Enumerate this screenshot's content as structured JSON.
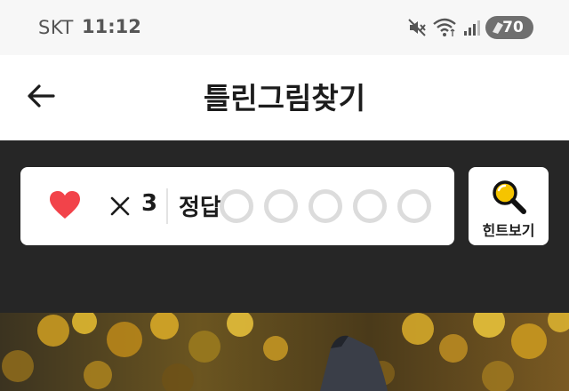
{
  "status_bar": {
    "carrier": "SKT",
    "time": "11:12",
    "battery_level": "70",
    "icons": [
      "mute-icon",
      "wifi-icon",
      "signal-icon",
      "battery-icon"
    ]
  },
  "app_bar": {
    "title": "틀린그림찾기",
    "back_icon": "arrow-left-icon"
  },
  "game": {
    "lives_symbol": "×",
    "lives_count": "3",
    "answer_label": "정답",
    "answers_found": 0,
    "answers_total": 5,
    "hint_label": "힌트보기",
    "hint_icon": "magnifier-icon",
    "colors": {
      "heart": "#f2434a",
      "hint_accent": "#f5c400",
      "panel_background": "#262626"
    }
  },
  "puzzle": {
    "image": "autumn-photo"
  }
}
